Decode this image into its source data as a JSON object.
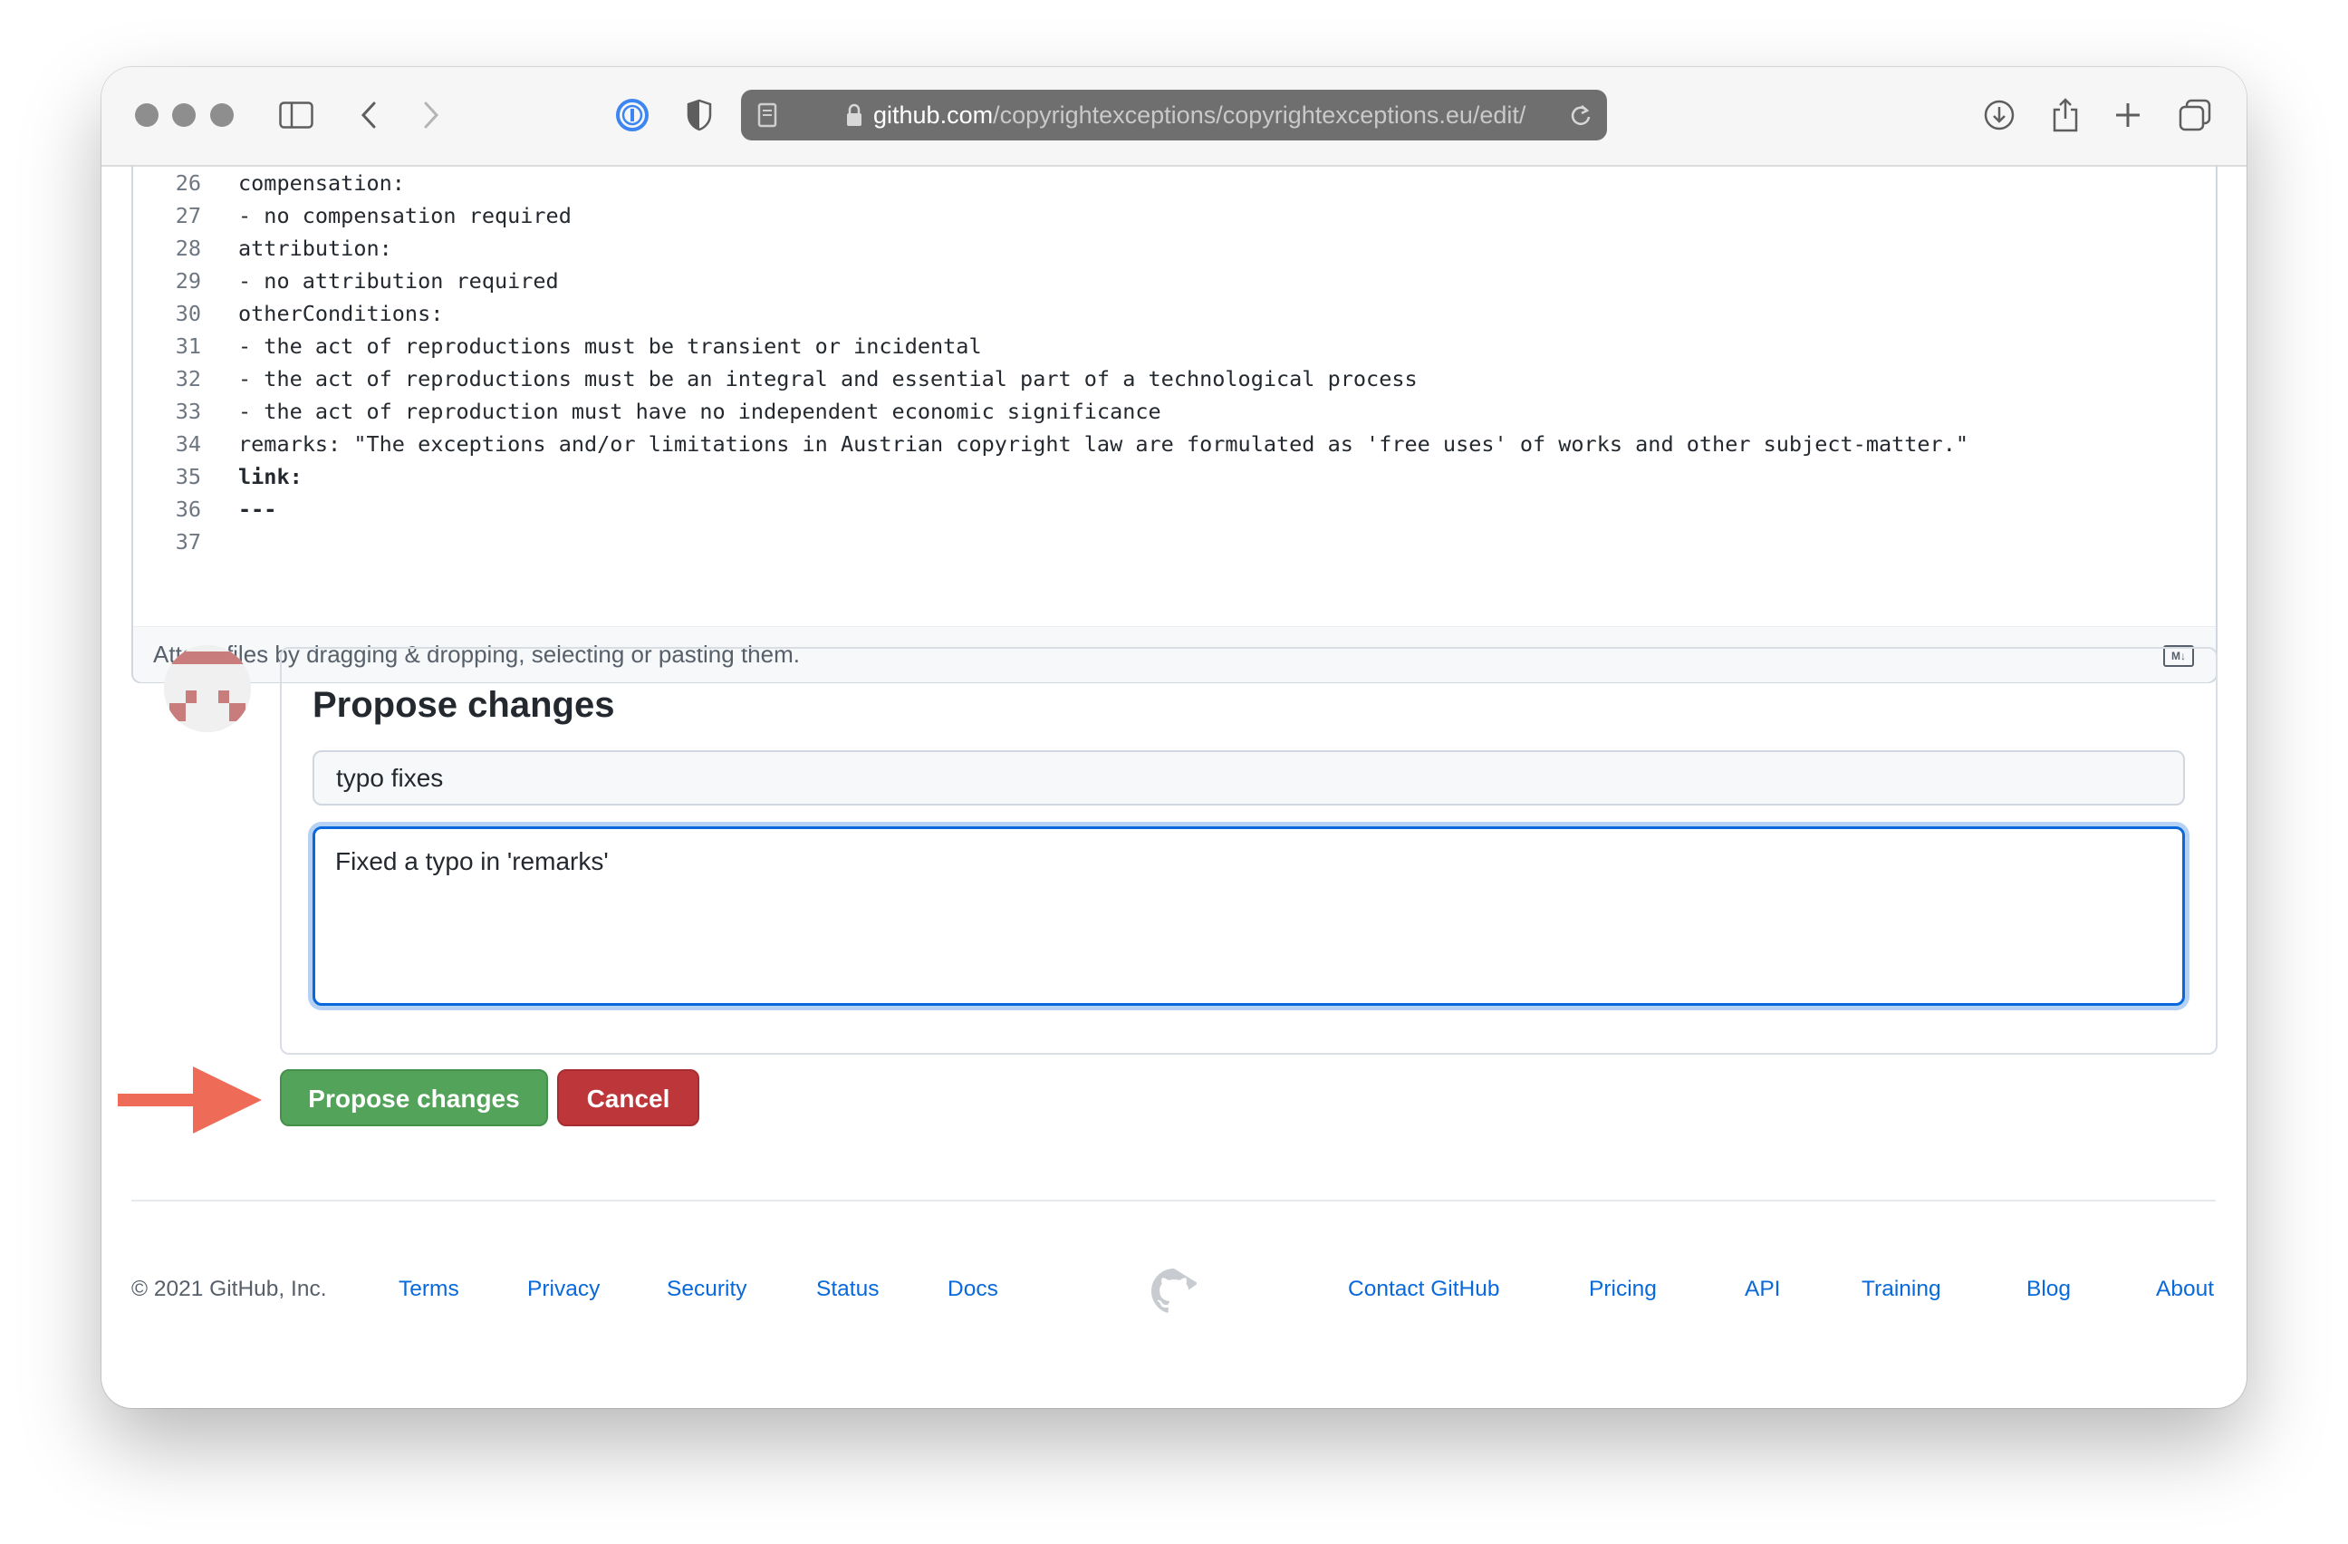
{
  "browser": {
    "url_host": "github.com",
    "url_path": "/copyrightexceptions/copyrightexceptions.eu/edit/",
    "icons": [
      "sidebar-icon",
      "back-icon",
      "forward-icon",
      "password-manager-icon",
      "privacy-shield-icon",
      "reader-icon",
      "lock-icon",
      "reload-icon",
      "download-icon",
      "share-icon",
      "new-tab-icon",
      "tabs-overview-icon"
    ]
  },
  "editor": {
    "lines": [
      {
        "num": "26",
        "text": "compensation:"
      },
      {
        "num": "27",
        "text": "- no compensation required"
      },
      {
        "num": "28",
        "text": "attribution:"
      },
      {
        "num": "29",
        "text": "- no attribution required"
      },
      {
        "num": "30",
        "text": "otherConditions:"
      },
      {
        "num": "31",
        "text": "- the act of reproductions must be transient or incidental"
      },
      {
        "num": "32",
        "text": "- the act of reproductions must be an integral and essential part of a technological process"
      },
      {
        "num": "33",
        "text": "- the act of reproduction must have no independent economic significance"
      },
      {
        "num": "34",
        "text": "remarks: \"The exceptions and/or limitations in Austrian copyright law are formulated as 'free uses' of works and other subject-matter.\""
      },
      {
        "num": "35",
        "text": "link:"
      },
      {
        "num": "36",
        "text": "---"
      },
      {
        "num": "37",
        "text": ""
      }
    ],
    "attach_hint": "Attach files by dragging & dropping, selecting or pasting them.",
    "markdown_badge": "M↓"
  },
  "propose": {
    "title": "Propose changes",
    "summary_value": "typo fixes",
    "description_value": "Fixed a typo in 'remarks'",
    "submit_label": "Propose changes",
    "cancel_label": "Cancel"
  },
  "footer": {
    "copyright": "© 2021 GitHub, Inc.",
    "links_left": [
      "Terms",
      "Privacy",
      "Security",
      "Status",
      "Docs"
    ],
    "links_right": [
      "Contact GitHub",
      "Pricing",
      "API",
      "Training",
      "Blog",
      "About"
    ]
  },
  "colors": {
    "accent_blue": "#0969da",
    "submit_green": "#53a35a",
    "cancel_red": "#bd3639",
    "annotation_arrow": "#ee6b58"
  }
}
